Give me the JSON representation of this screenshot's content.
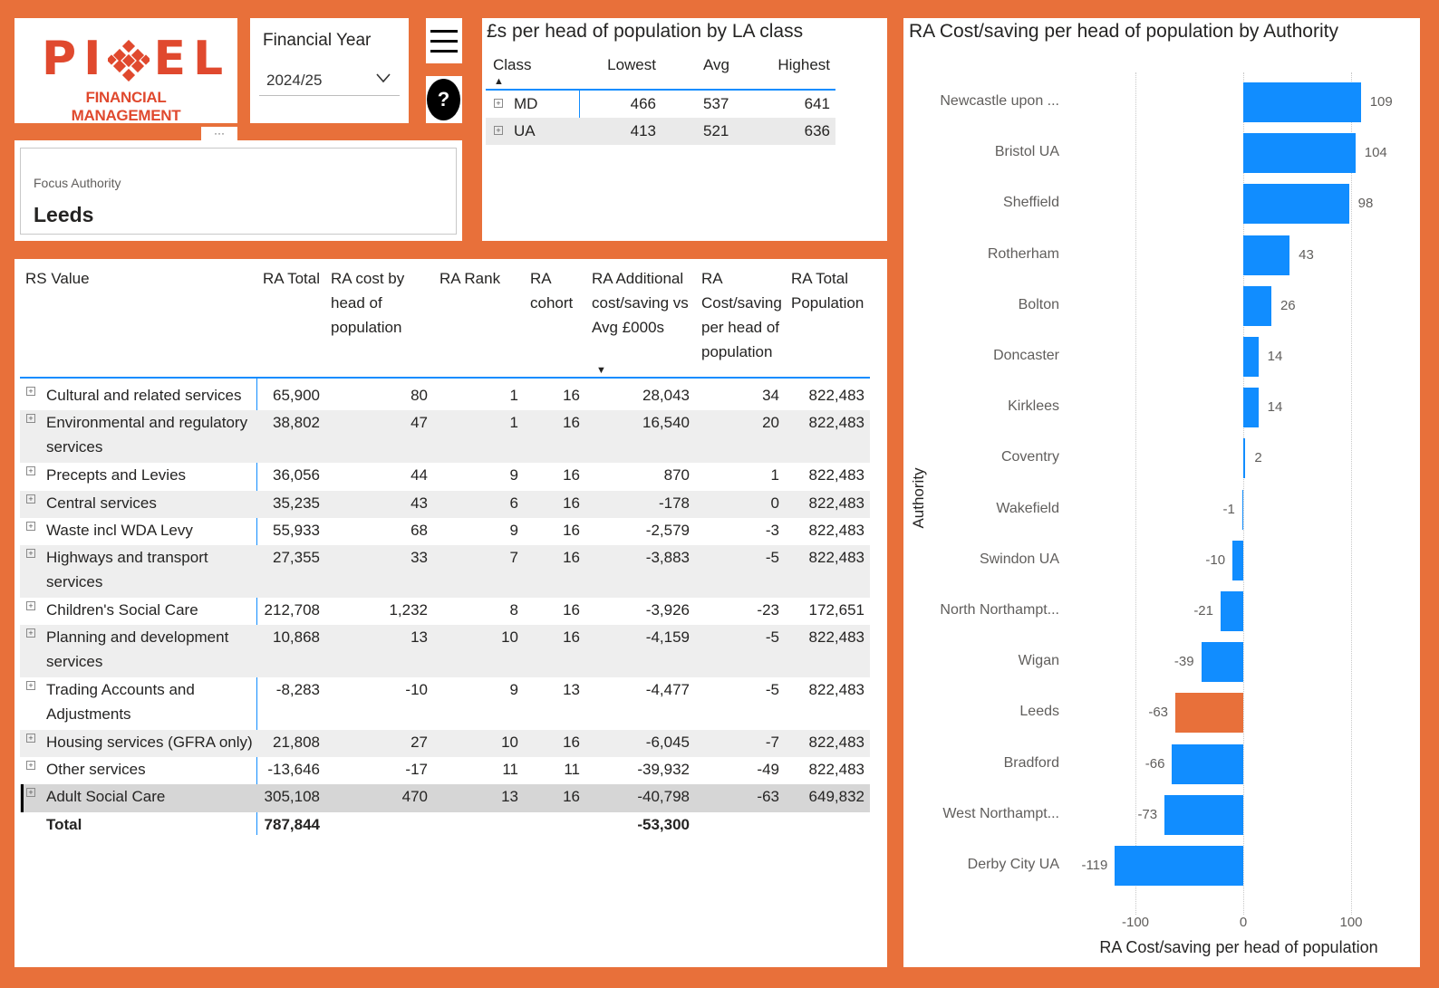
{
  "logo": {
    "word_left": "PI",
    "word_right": "EL",
    "subtitle": "FINANCIAL MANAGEMENT"
  },
  "year_slicer": {
    "title": "Financial Year",
    "value": "2024/25"
  },
  "help": {
    "label": "?"
  },
  "focus": {
    "label": "Focus Authority",
    "value": "Leeds"
  },
  "class_table": {
    "title": "£s per head of population by LA class",
    "headers": [
      "Class",
      "Lowest",
      "Avg",
      "Highest"
    ],
    "rows": [
      {
        "cls": "MD",
        "lowest": "466",
        "avg": "537",
        "highest": "641"
      },
      {
        "cls": "UA",
        "lowest": "413",
        "avg": "521",
        "highest": "636"
      }
    ]
  },
  "main_table": {
    "headers": {
      "rs_value": "RS Value",
      "ra_total": "RA Total",
      "ra_cost_head": "RA cost by head of population",
      "ra_rank": "RA Rank",
      "ra_cohort": "RA cohort",
      "ra_additional": "RA Additional cost/saving vs Avg £000s",
      "ra_cost_saving": "RA Cost/saving per head of population",
      "ra_population": "RA Total Population"
    },
    "rows": [
      {
        "name": "Cultural and related services",
        "name2": "",
        "total": "65,900",
        "head": "80",
        "rank": "1",
        "cohort": "16",
        "add": "28,043",
        "cs": "34",
        "pop": "822,483"
      },
      {
        "name": "Environmental and regulatory",
        "name2": "services",
        "total": "38,802",
        "head": "47",
        "rank": "1",
        "cohort": "16",
        "add": "16,540",
        "cs": "20",
        "pop": "822,483"
      },
      {
        "name": "Precepts and Levies",
        "name2": "",
        "total": "36,056",
        "head": "44",
        "rank": "9",
        "cohort": "16",
        "add": "870",
        "cs": "1",
        "pop": "822,483"
      },
      {
        "name": "Central services",
        "name2": "",
        "total": "35,235",
        "head": "43",
        "rank": "6",
        "cohort": "16",
        "add": "-178",
        "cs": "0",
        "pop": "822,483"
      },
      {
        "name": "Waste incl WDA Levy",
        "name2": "",
        "total": "55,933",
        "head": "68",
        "rank": "9",
        "cohort": "16",
        "add": "-2,579",
        "cs": "-3",
        "pop": "822,483"
      },
      {
        "name": "Highways and transport",
        "name2": "services",
        "total": "27,355",
        "head": "33",
        "rank": "7",
        "cohort": "16",
        "add": "-3,883",
        "cs": "-5",
        "pop": "822,483"
      },
      {
        "name": "Children's Social Care",
        "name2": "",
        "total": "212,708",
        "head": "1,232",
        "rank": "8",
        "cohort": "16",
        "add": "-3,926",
        "cs": "-23",
        "pop": "172,651"
      },
      {
        "name": "Planning and development",
        "name2": "services",
        "total": "10,868",
        "head": "13",
        "rank": "10",
        "cohort": "16",
        "add": "-4,159",
        "cs": "-5",
        "pop": "822,483"
      },
      {
        "name": "Trading Accounts and",
        "name2": "Adjustments",
        "total": "-8,283",
        "head": "-10",
        "rank": "9",
        "cohort": "13",
        "add": "-4,477",
        "cs": "-5",
        "pop": "822,483"
      },
      {
        "name": "Housing services (GFRA only)",
        "name2": "",
        "total": "21,808",
        "head": "27",
        "rank": "10",
        "cohort": "16",
        "add": "-6,045",
        "cs": "-7",
        "pop": "822,483"
      },
      {
        "name": "Other services",
        "name2": "",
        "total": "-13,646",
        "head": "-17",
        "rank": "11",
        "cohort": "11",
        "add": "-39,932",
        "cs": "-49",
        "pop": "822,483"
      },
      {
        "name": "Adult Social Care",
        "name2": "",
        "total": "305,108",
        "head": "470",
        "rank": "13",
        "cohort": "16",
        "add": "-40,798",
        "cs": "-63",
        "pop": "649,832"
      }
    ],
    "total": {
      "label": "Total",
      "total": "787,844",
      "add": "-53,300"
    }
  },
  "chart_data": {
    "type": "bar",
    "orientation": "horizontal",
    "title": "RA Cost/saving per head of population by Authority",
    "xlabel": "RA Cost/saving per head of population",
    "ylabel": "Authority",
    "xlim": [
      -130,
      120
    ],
    "xticks": [
      "-100",
      "0",
      "100"
    ],
    "tick_values": [
      -100,
      0,
      100
    ],
    "grid": true,
    "colors": {
      "default": "#118dff",
      "highlight": "#e8703a"
    },
    "categories": [
      "Newcastle upon ...",
      "Bristol UA",
      "Sheffield",
      "Rotherham",
      "Bolton",
      "Doncaster",
      "Kirklees",
      "Coventry",
      "Wakefield",
      "Swindon UA",
      "North Northampt...",
      "Wigan",
      "Leeds",
      "Bradford",
      "West Northampt...",
      "Derby City UA"
    ],
    "values": [
      109,
      104,
      98,
      43,
      26,
      14,
      14,
      2,
      -1,
      -10,
      -21,
      -39,
      -63,
      -66,
      -73,
      -119
    ],
    "highlight": "Leeds"
  }
}
